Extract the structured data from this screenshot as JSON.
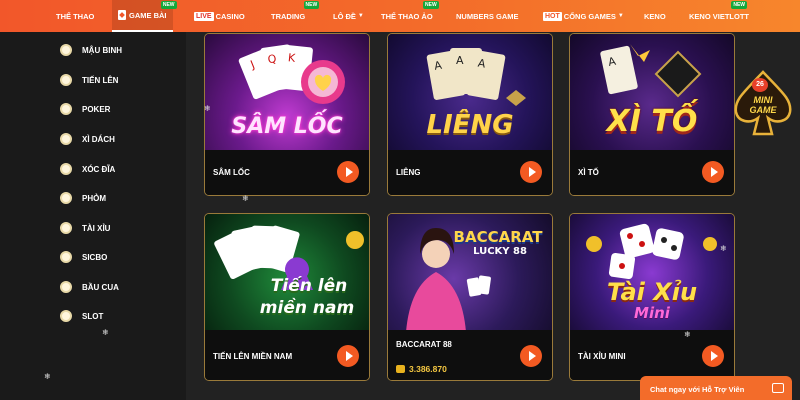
{
  "nav": {
    "items": [
      {
        "label": "THỂ THAO"
      },
      {
        "label": "GAME BÀI",
        "badge": "NEW"
      },
      {
        "label": "CASINO",
        "tag": "LIVE"
      },
      {
        "label": "TRADING",
        "badge": "NEW"
      },
      {
        "label": "LÔ ĐỀ"
      },
      {
        "label": "THỂ THAO ẢO",
        "badge": "NEW"
      },
      {
        "label": "NUMBERS GAME"
      },
      {
        "label": "CỔNG GAMES",
        "tag": "HOT"
      },
      {
        "label": "KENO"
      },
      {
        "label": "KENO VIETLOTT",
        "badge": "NEW"
      }
    ]
  },
  "sidebar": {
    "items": [
      {
        "label": "MẬU BINH"
      },
      {
        "label": "TIẾN LÊN"
      },
      {
        "label": "POKER"
      },
      {
        "label": "XÌ DÁCH"
      },
      {
        "label": "XÓC ĐĨA"
      },
      {
        "label": "PHỎM"
      },
      {
        "label": "TÀI XỈU"
      },
      {
        "label": "SICBO"
      },
      {
        "label": "BẦU CUA"
      },
      {
        "label": "SLOT"
      }
    ]
  },
  "games": [
    {
      "title": "SÂM LỐC",
      "art": "SÂM LỐC"
    },
    {
      "title": "LIÊNG",
      "art": "LIÊNG"
    },
    {
      "title": "XÌ TỐ",
      "art": "XÌ TỐ"
    },
    {
      "title": "TIẾN LÊN MIỀN NAM",
      "art1": "Tiến lên",
      "art2": "miền nam"
    },
    {
      "title": "BACCARAT 88",
      "art1": "BACCARAT",
      "art2": "LUCKY 88",
      "jackpot": "3.386.870"
    },
    {
      "title": "TÀI XỈU MINI",
      "art1": "Tài Xỉu",
      "art2": "Mini"
    }
  ],
  "mini_game": {
    "number": "26",
    "line1": "MINI",
    "line2": "GAME"
  },
  "chat": {
    "label": "Chat ngay với Hỗ Trợ Viên"
  },
  "colors": {
    "accent": "#f35a22",
    "nav": "#f36c2a",
    "gold": "#f5c842"
  }
}
